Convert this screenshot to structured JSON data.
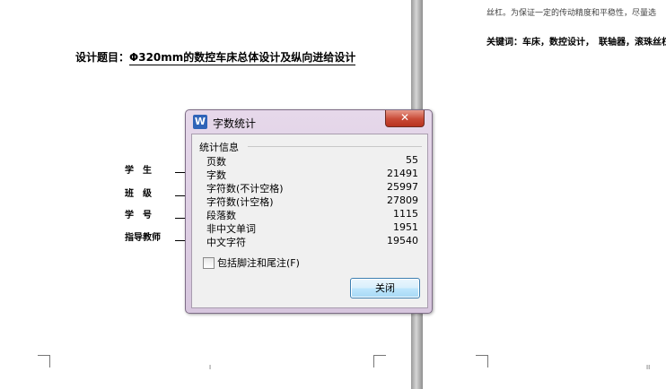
{
  "document": {
    "title_prefix": "设计题目：",
    "title_topic": "Φ320mm的数控车床总体设计及纵向进给设计",
    "fields": [
      "学　生",
      "班　级",
      "学　号",
      "指导教师"
    ],
    "left_page_number": "I",
    "right_page_number": "II",
    "right_page_line1": "丝杠。为保证一定的传动精度和平稳性，尽量选",
    "right_page_keywords": "关键词：车床，数控设计，　联轴器，滚珠丝杠"
  },
  "dialog": {
    "title": "字数统计",
    "app_icon": "W",
    "close_symbol": "✕",
    "group_label": "统计信息",
    "stats": [
      {
        "label": "页数",
        "value": "55"
      },
      {
        "label": "字数",
        "value": "21491"
      },
      {
        "label": "字符数(不计空格)",
        "value": "25997"
      },
      {
        "label": "字符数(计空格)",
        "value": "27809"
      },
      {
        "label": "段落数",
        "value": "1115"
      },
      {
        "label": "非中文单词",
        "value": "1951"
      },
      {
        "label": "中文字符",
        "value": "19540"
      }
    ],
    "checkbox_label": "包括脚注和尾注(F)",
    "checkbox_checked": false,
    "ok_label": "关闭"
  }
}
